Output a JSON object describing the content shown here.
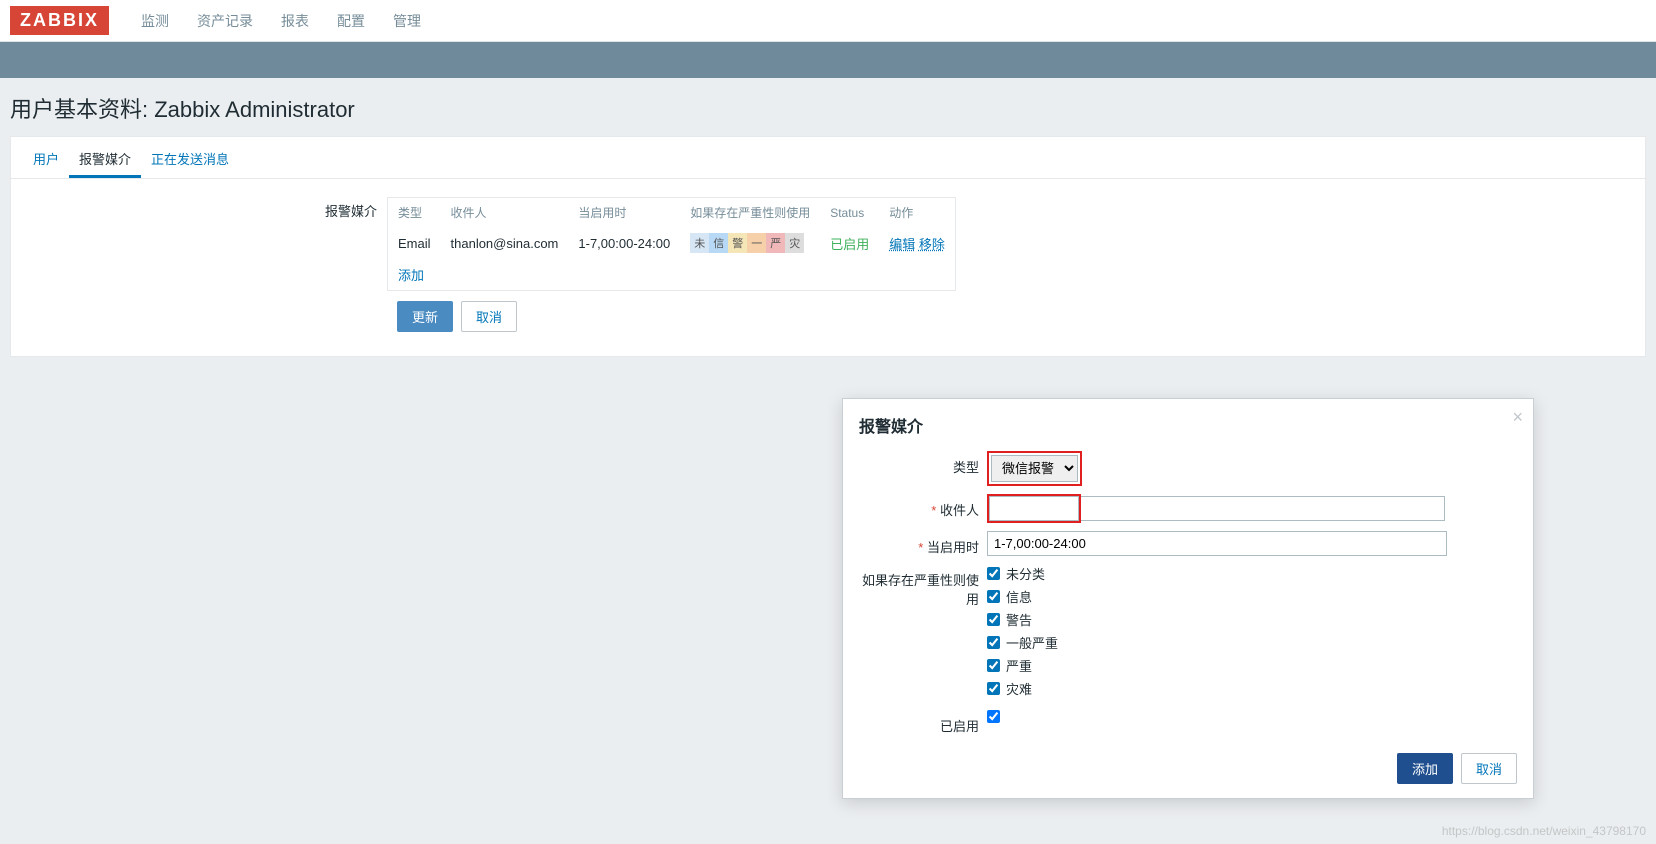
{
  "brand": "ZABBIX",
  "nav": {
    "items": [
      "监测",
      "资产记录",
      "报表",
      "配置",
      "管理"
    ]
  },
  "page_title": "用户基本资料: Zabbix Administrator",
  "tabs": {
    "items": [
      "用户",
      "报警媒介",
      "正在发送消息"
    ],
    "active_index": 1
  },
  "media_section": {
    "label": "报警媒介",
    "headers": {
      "type": "类型",
      "recipient": "收件人",
      "when": "当启用时",
      "severity": "如果存在严重性则使用",
      "status": "Status",
      "actions": "动作"
    },
    "rows": [
      {
        "type": "Email",
        "recipient": "thanlon@sina.com",
        "when": "1-7,00:00-24:00",
        "sev": [
          "未",
          "信",
          "警",
          "一",
          "严",
          "灾"
        ],
        "status": "已启用",
        "edit": "编辑",
        "remove": "移除"
      }
    ],
    "add": "添加"
  },
  "buttons": {
    "update": "更新",
    "cancel": "取消"
  },
  "modal": {
    "title": "报警媒介",
    "labels": {
      "type": "类型",
      "recipient": "收件人",
      "when": "当启用时",
      "severity": "如果存在严重性则使用",
      "enabled": "已启用"
    },
    "type_value": "微信报警",
    "recipient_value": "",
    "when_value": "1-7,00:00-24:00",
    "severity_options": [
      "未分类",
      "信息",
      "警告",
      "一般严重",
      "严重",
      "灾难"
    ],
    "enabled": true,
    "add": "添加",
    "cancel": "取消"
  },
  "watermark": "https://blog.csdn.net/weixin_43798170"
}
